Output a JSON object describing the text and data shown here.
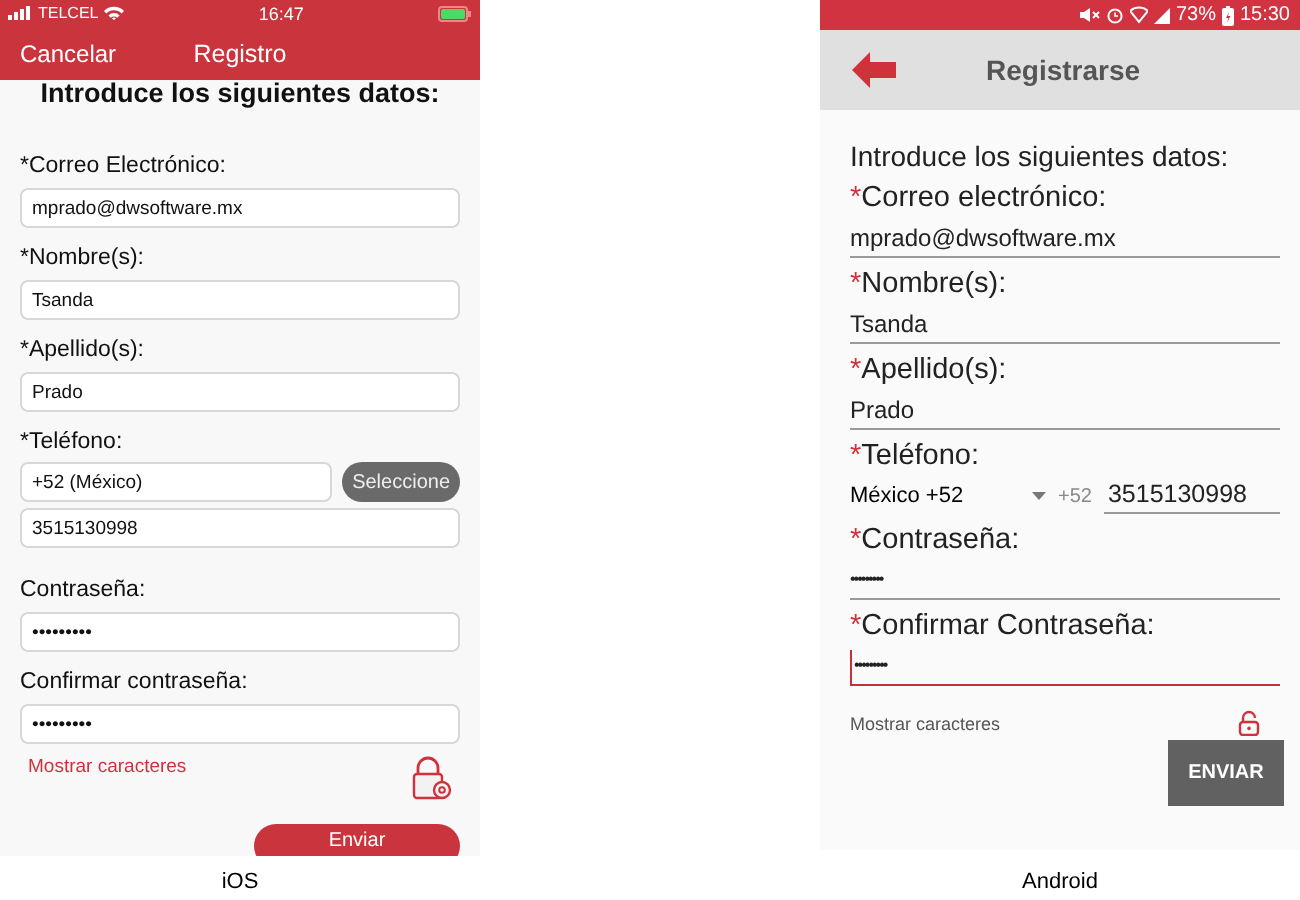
{
  "ios": {
    "status_bar": {
      "carrier": "TELCEL",
      "time": "16:47"
    },
    "nav": {
      "cancel": "Cancelar",
      "title": "Registro"
    },
    "heading": "Introduce los siguientes datos:",
    "fields": [
      {
        "kind": "text",
        "label": "*Correo Electrónico:",
        "value": "mprado@dwsoftware.mx"
      },
      {
        "kind": "text",
        "label": "*Nombre(s):",
        "value": "Tsanda"
      },
      {
        "kind": "text",
        "label": "*Apellido(s):",
        "value": "Prado"
      },
      {
        "kind": "phone",
        "label": "*Teléfono:",
        "country": "+52 (México)",
        "button": "Seleccione",
        "value": "3515130998"
      },
      {
        "kind": "password",
        "label": "Contraseña:",
        "value": "•••••••••"
      },
      {
        "kind": "password",
        "label": "Confirmar contraseña:",
        "value": "•••••••••"
      }
    ],
    "show_characters": "Mostrar caracteres",
    "submit": "Enviar",
    "caption": "iOS"
  },
  "android": {
    "status_bar": {
      "battery": "73%",
      "time": "15:30"
    },
    "header": {
      "title": "Registrarse"
    },
    "heading": "Introduce los siguientes datos:",
    "required_mark": "*",
    "fields": [
      {
        "kind": "text",
        "label": "Correo electrónico:",
        "required": true,
        "value": "mprado@dwsoftware.mx",
        "focused": false
      },
      {
        "kind": "text",
        "label": "Nombre(s):",
        "required": true,
        "value": "Tsanda",
        "focused": false
      },
      {
        "kind": "text",
        "label": "Apellido(s):",
        "required": true,
        "value": "Prado",
        "focused": false
      },
      {
        "kind": "phone",
        "label": "Teléfono:",
        "required": true,
        "country": "México +52",
        "code": "+52",
        "value": "3515130998",
        "focused": false
      },
      {
        "kind": "password",
        "label": "Contraseña:",
        "required": true,
        "value": "•••••••••",
        "focused": false
      },
      {
        "kind": "password",
        "label": "Confirmar Contraseña:",
        "required": true,
        "value": "•••••••••",
        "focused": true
      }
    ],
    "show_characters": "Mostrar caracteres",
    "submit": "ENVIAR",
    "caption": "Android"
  }
}
